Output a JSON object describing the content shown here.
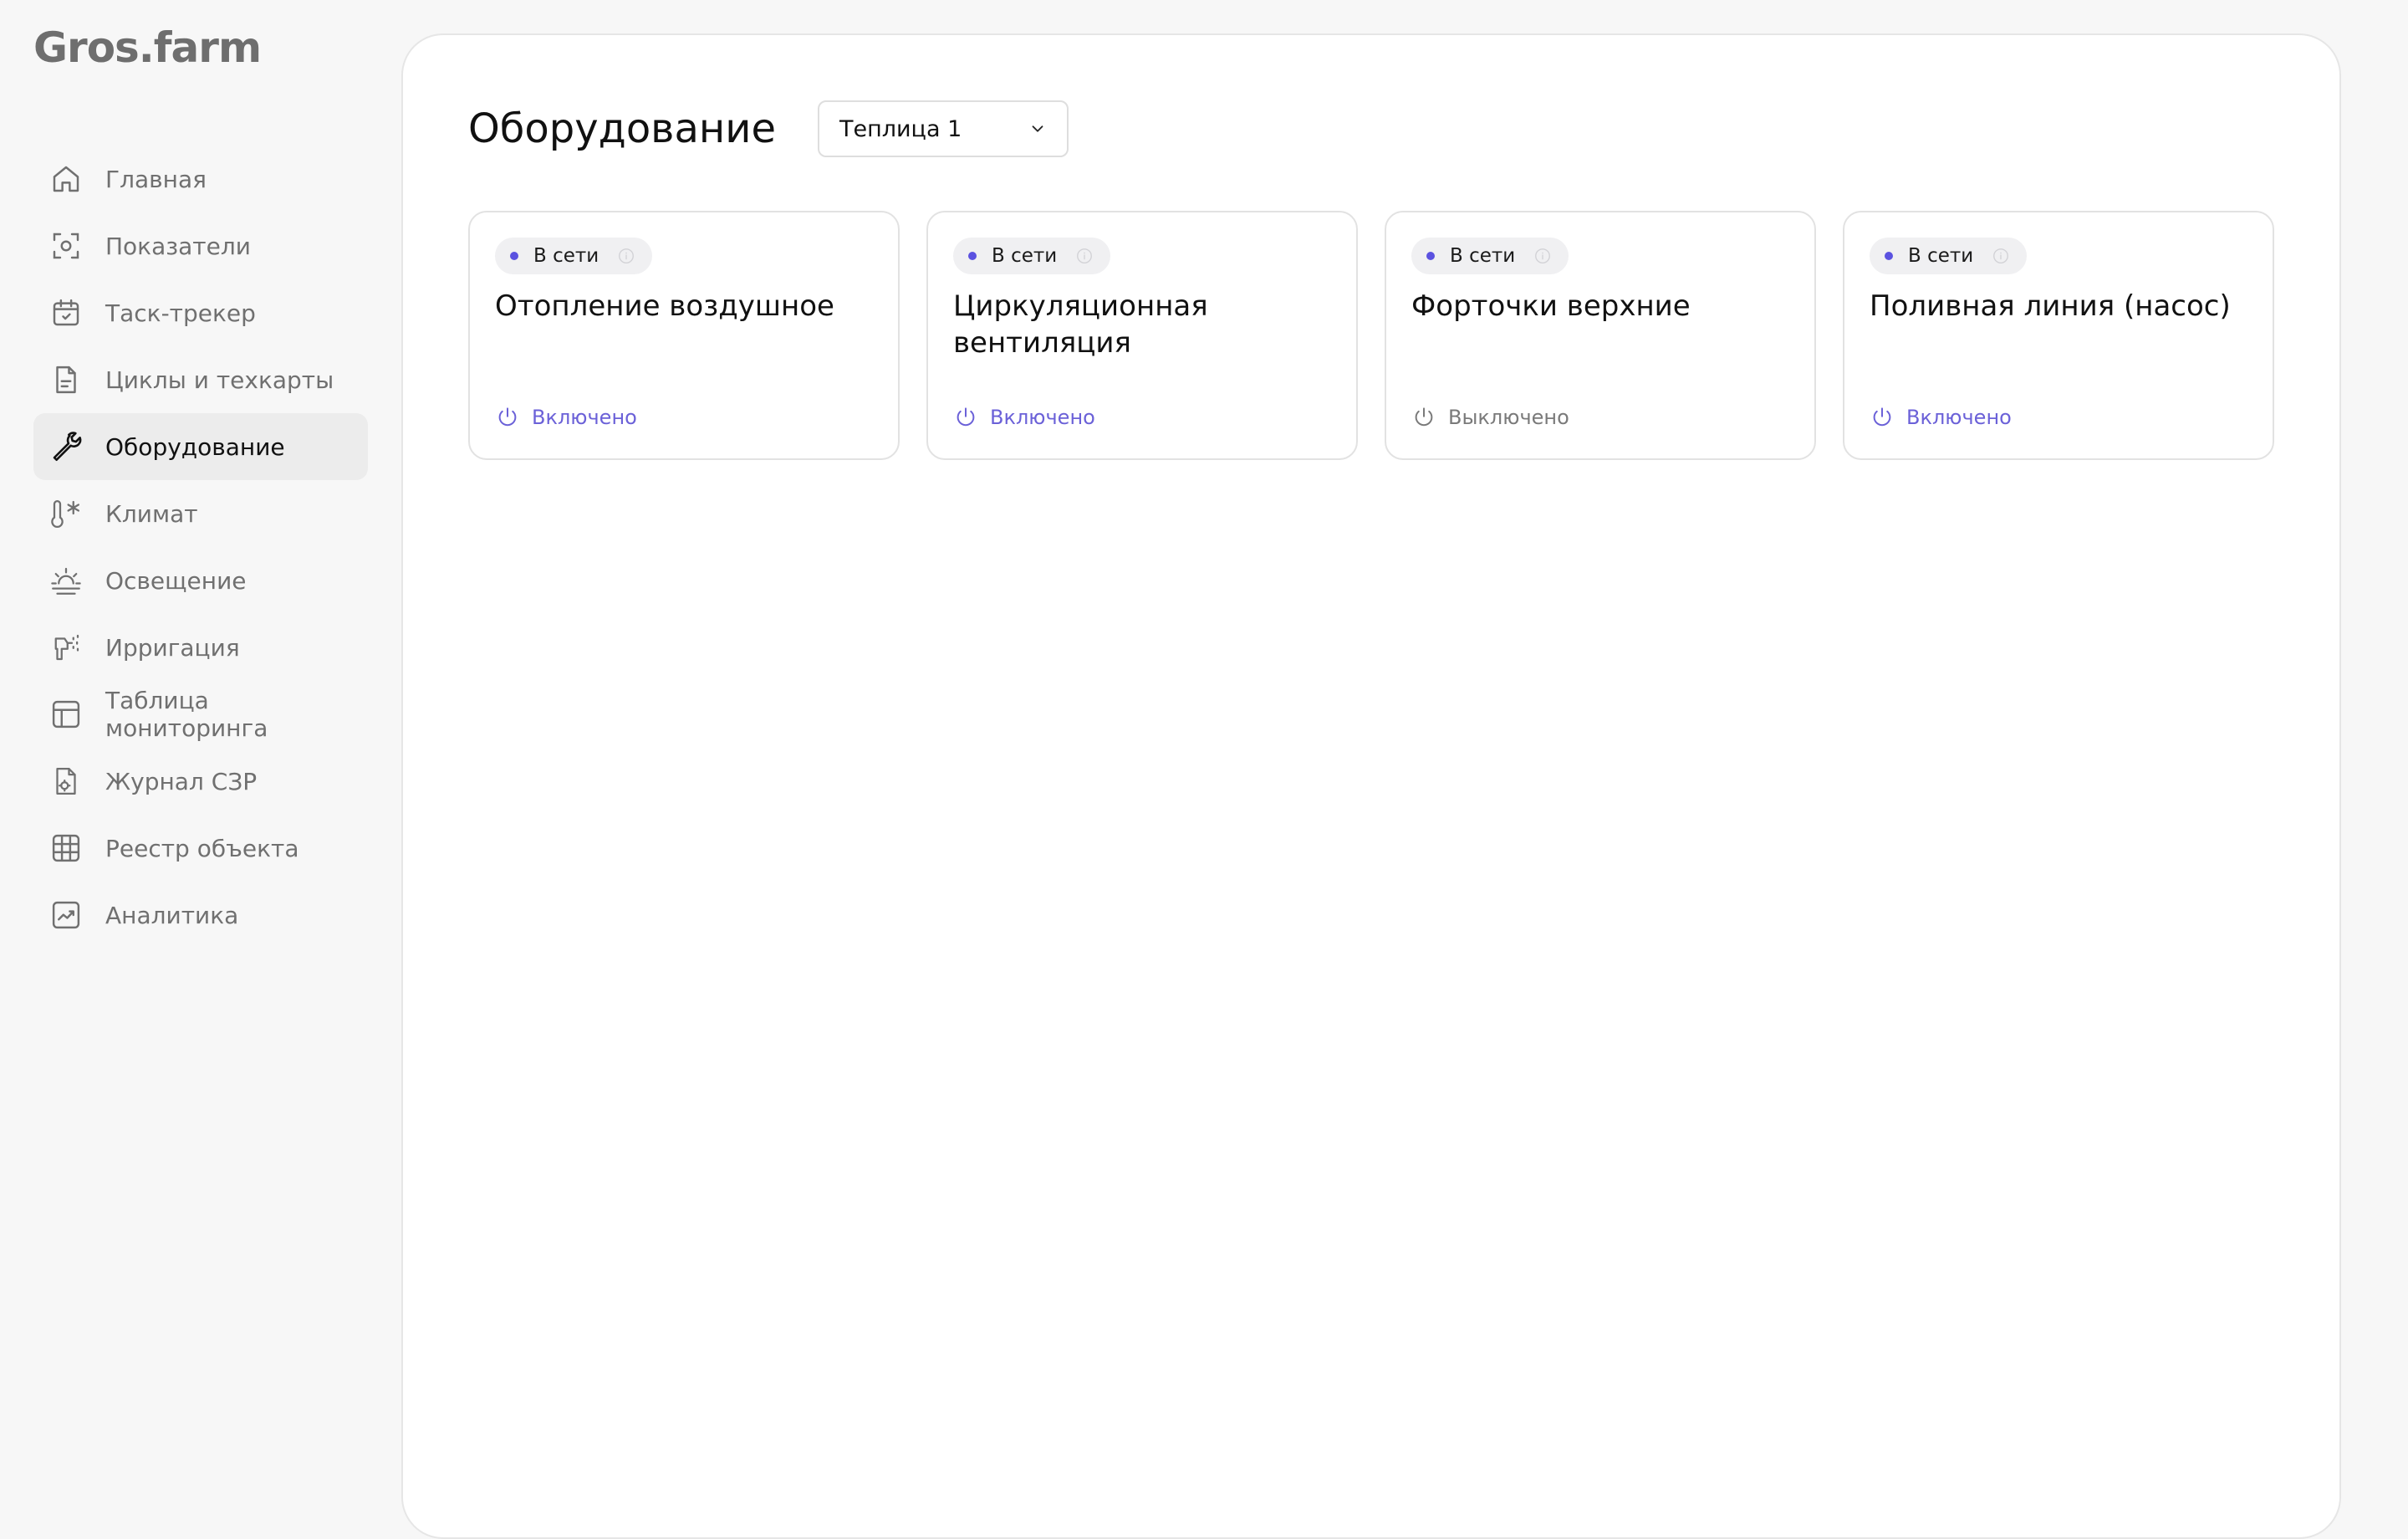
{
  "app": {
    "logo": "Gros.farm"
  },
  "sidebar": {
    "items": [
      {
        "label": "Главная",
        "icon": "home-icon"
      },
      {
        "label": "Показатели",
        "icon": "indicators-icon"
      },
      {
        "label": "Таск-трекер",
        "icon": "calendar-icon"
      },
      {
        "label": "Циклы и техкарты",
        "icon": "document-icon"
      },
      {
        "label": "Оборудование",
        "icon": "wrench-icon",
        "active": true
      },
      {
        "label": "Климат",
        "icon": "thermometer-icon"
      },
      {
        "label": "Освещение",
        "icon": "sunrise-icon"
      },
      {
        "label": "Ирригация",
        "icon": "irrigation-icon"
      },
      {
        "label": "Таблица мониторинга",
        "icon": "table-icon"
      },
      {
        "label": "Журнал СЗР",
        "icon": "journal-icon"
      },
      {
        "label": "Реестр объекта",
        "icon": "grid-icon"
      },
      {
        "label": "Аналитика",
        "icon": "chart-icon"
      }
    ]
  },
  "main": {
    "title": "Оборудование",
    "greenhouse_select": {
      "value": "Теплица 1"
    },
    "cards": [
      {
        "badge": "В сети",
        "title": "Отопление воздушное",
        "status": "Включено",
        "on": true
      },
      {
        "badge": "В сети",
        "title": "Циркуляционная вентиляция",
        "status": "Включено",
        "on": true
      },
      {
        "badge": "В сети",
        "title": "Форточки верхние",
        "status": "Выключено",
        "on": false
      },
      {
        "badge": "В сети",
        "title": "Поливная линия (насос)",
        "status": "Включено",
        "on": true
      }
    ]
  },
  "colors": {
    "accent": "#5b52e0",
    "status_on": "#6b61d8",
    "status_off": "#7a7a7a",
    "active_nav_bg": "#ececec"
  }
}
